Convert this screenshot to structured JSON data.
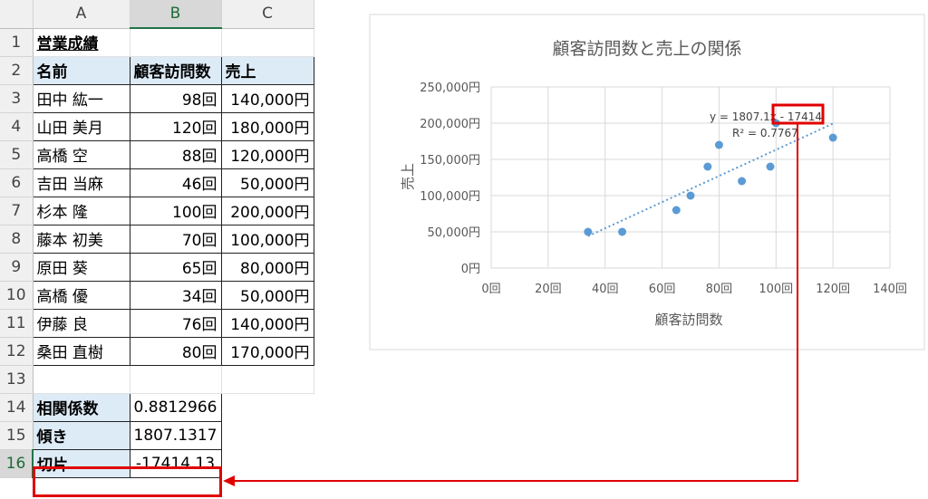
{
  "spreadsheet": {
    "columns": [
      "A",
      "B",
      "C"
    ],
    "selected_column": "B",
    "selected_row": "16",
    "title": "営業成績",
    "headers": [
      "名前",
      "顧客訪問数",
      "売上"
    ],
    "rows": [
      {
        "num": "3",
        "name": "田中 紘一",
        "visits": "98回",
        "sales": "140,000円"
      },
      {
        "num": "4",
        "name": "山田 美月",
        "visits": "120回",
        "sales": "180,000円"
      },
      {
        "num": "5",
        "name": "高橋 空",
        "visits": "88回",
        "sales": "120,000円"
      },
      {
        "num": "6",
        "name": "吉田 当麻",
        "visits": "46回",
        "sales": "50,000円"
      },
      {
        "num": "7",
        "name": "杉本 隆",
        "visits": "100回",
        "sales": "200,000円"
      },
      {
        "num": "8",
        "name": "藤本 初美",
        "visits": "70回",
        "sales": "100,000円"
      },
      {
        "num": "9",
        "name": "原田 葵",
        "visits": "65回",
        "sales": "80,000円"
      },
      {
        "num": "10",
        "name": "高橋 優",
        "visits": "34回",
        "sales": "50,000円"
      },
      {
        "num": "11",
        "name": "伊藤 良",
        "visits": "76回",
        "sales": "140,000円"
      },
      {
        "num": "12",
        "name": "桑田 直樹",
        "visits": "80回",
        "sales": "170,000円"
      }
    ],
    "stats": [
      {
        "num": "14",
        "label": "相関係数",
        "value": "0.8812966"
      },
      {
        "num": "15",
        "label": "傾き",
        "value": "1807.1317"
      },
      {
        "num": "16",
        "label": "切片",
        "value": "-17414.13"
      }
    ],
    "row_numbers": {
      "title": "1",
      "header": "2",
      "blank": "13"
    }
  },
  "chart_data": {
    "type": "scatter",
    "title": "顧客訪問数と売上の関係",
    "xlabel": "顧客訪問数",
    "ylabel": "売上",
    "xlim": [
      0,
      140
    ],
    "ylim": [
      0,
      250000
    ],
    "x_ticks": [
      0,
      20,
      40,
      60,
      80,
      100,
      120,
      140
    ],
    "x_tick_labels": [
      "0回",
      "20回",
      "40回",
      "60回",
      "80回",
      "100回",
      "120回",
      "140回"
    ],
    "y_ticks": [
      0,
      50000,
      100000,
      150000,
      200000,
      250000
    ],
    "y_tick_labels": [
      "0円",
      "50,000円",
      "100,000円",
      "150,000円",
      "200,000円",
      "250,000円"
    ],
    "points": [
      {
        "x": 98,
        "y": 140000
      },
      {
        "x": 120,
        "y": 180000
      },
      {
        "x": 88,
        "y": 120000
      },
      {
        "x": 46,
        "y": 50000
      },
      {
        "x": 100,
        "y": 200000
      },
      {
        "x": 70,
        "y": 100000
      },
      {
        "x": 65,
        "y": 80000
      },
      {
        "x": 34,
        "y": 50000
      },
      {
        "x": 76,
        "y": 140000
      },
      {
        "x": 80,
        "y": 170000
      }
    ],
    "trendline": {
      "slope": 1807.1317,
      "intercept": -17414.13
    },
    "equation_label": "y = 1807.1x - 17414",
    "r2_label": "R² = 0.7767",
    "grid": true,
    "colors": {
      "points": "#5b9bd5",
      "trend": "#5b9bd5",
      "highlight": "#e00000"
    }
  }
}
